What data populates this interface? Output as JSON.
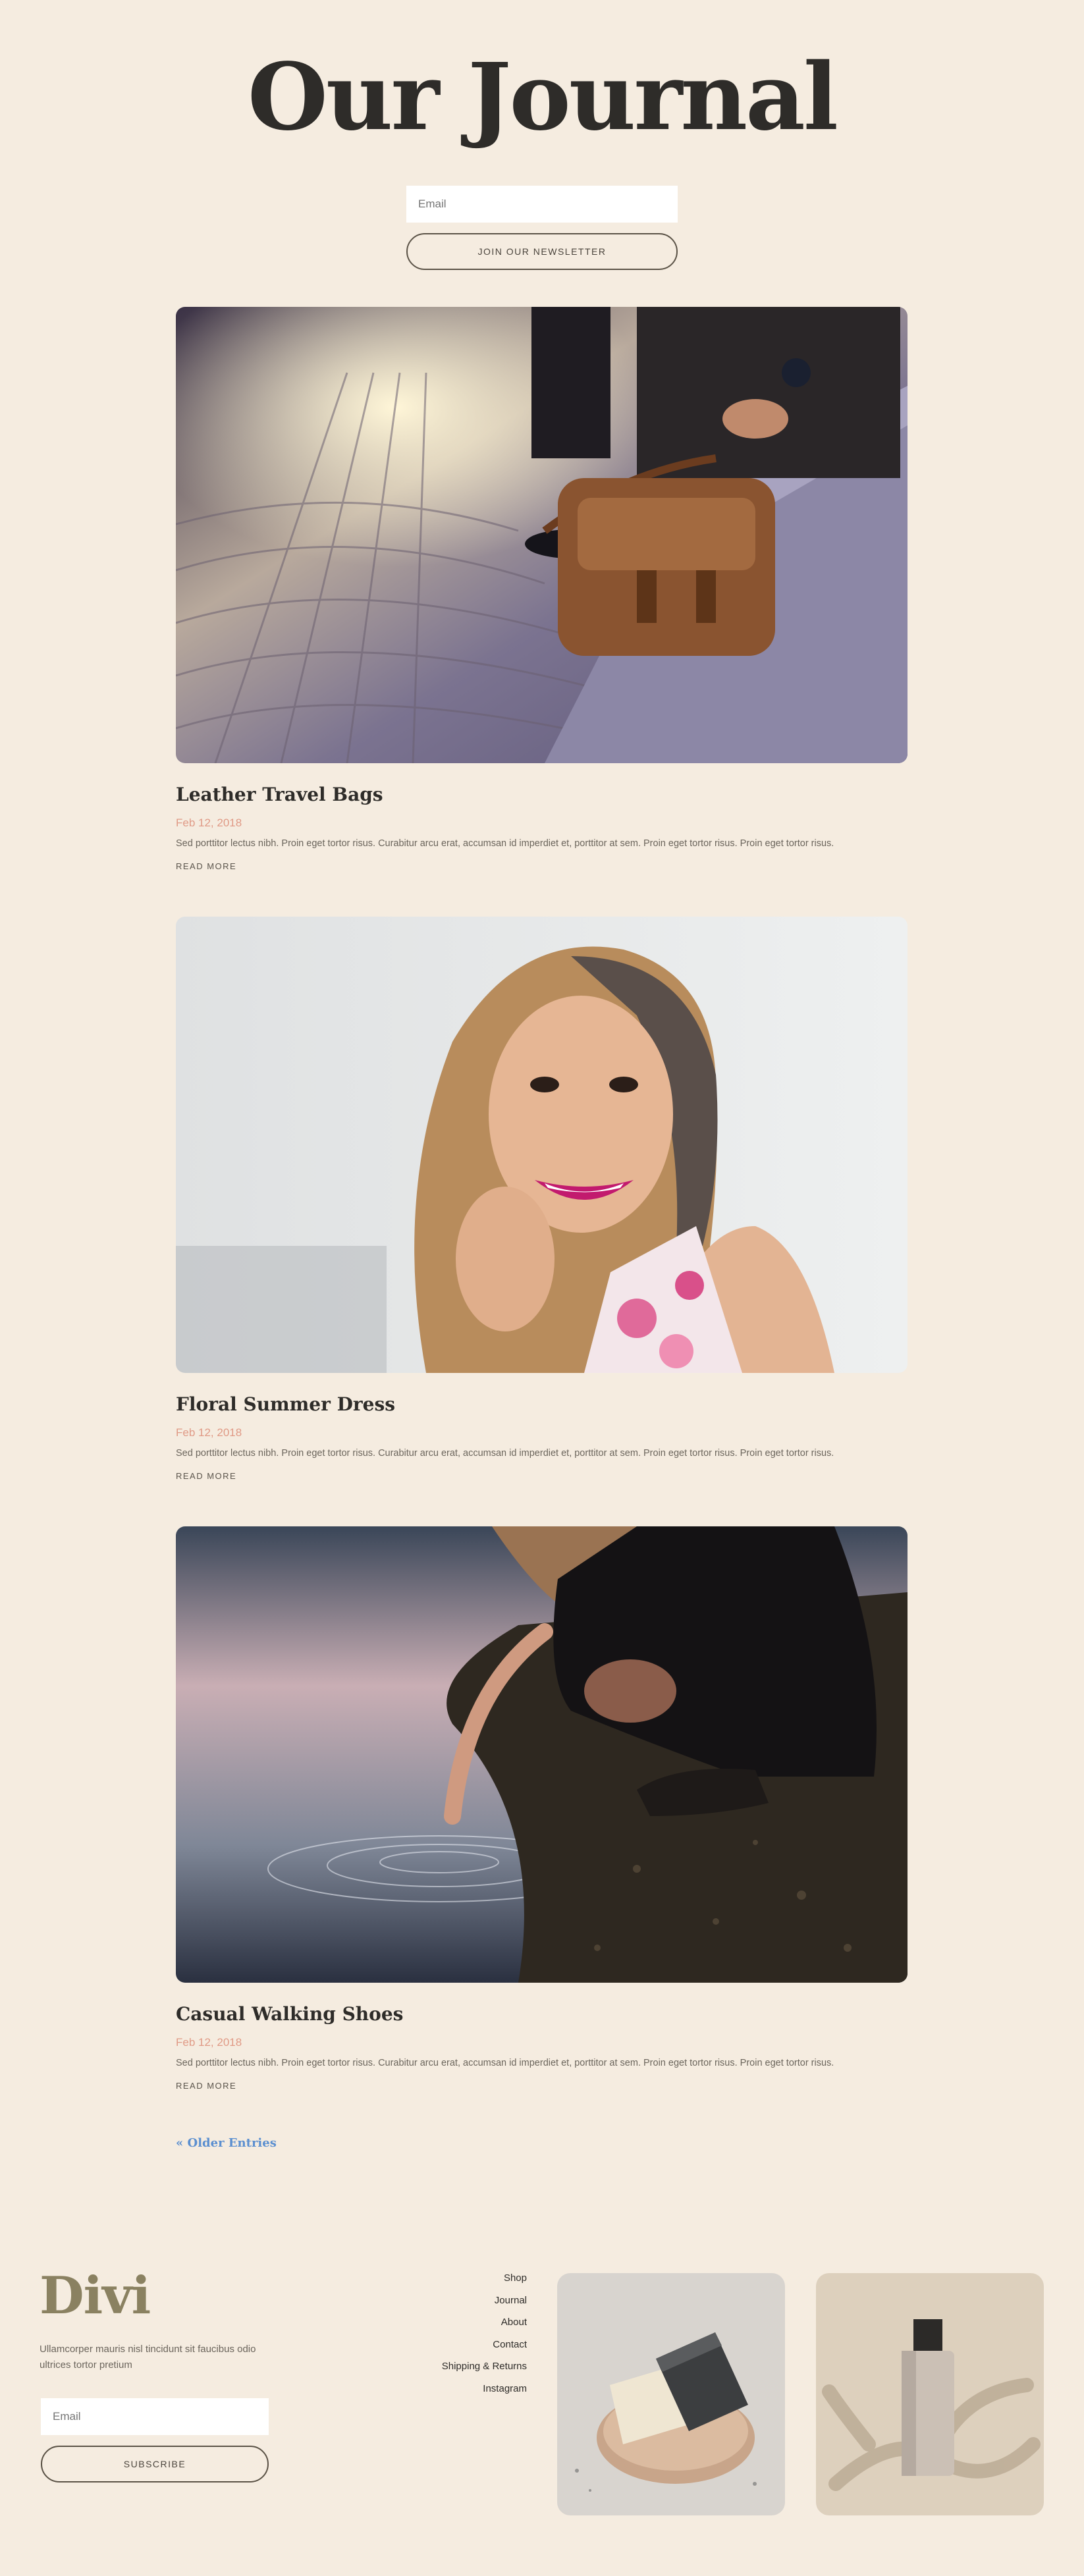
{
  "header": {
    "title": "Our Journal",
    "newsletter": {
      "email_placeholder": "Email",
      "button_label": "JOIN OUR NEWSLETTER"
    }
  },
  "posts": [
    {
      "title": "Leather Travel Bags",
      "date": "Feb 12, 2018",
      "excerpt": "Sed porttitor lectus nibh. Proin eget tortor risus. Curabitur arcu erat, accumsan id imperdiet et, porttitor at sem. Proin eget tortor risus. Proin eget tortor risus.",
      "read_more": "READ MORE",
      "image": "leather-bag-photo"
    },
    {
      "title": "Floral Summer Dress",
      "date": "Feb 12, 2018",
      "excerpt": "Sed porttitor lectus nibh. Proin eget tortor risus. Curabitur arcu erat, accumsan id imperdiet et, porttitor at sem. Proin eget tortor risus. Proin eget tortor risus.",
      "read_more": "READ MORE",
      "image": "smiling-woman-photo"
    },
    {
      "title": "Casual Walking Shoes",
      "date": "Feb 12, 2018",
      "excerpt": "Sed porttitor lectus nibh. Proin eget tortor risus. Curabitur arcu erat, accumsan id imperdiet et, porttitor at sem. Proin eget tortor risus. Proin eget tortor risus.",
      "read_more": "READ MORE",
      "image": "woman-at-water-photo"
    }
  ],
  "pagination": {
    "older_label": "« Older Entries"
  },
  "footer": {
    "logo": "Divi",
    "text": "Ullamcorper mauris nisl tincidunt sit faucibus odio ultrices tortor pretium",
    "email_placeholder": "Email",
    "subscribe_label": "SUBSCRIBE",
    "menu": [
      "Shop",
      "Journal",
      "About",
      "Contact",
      "Shipping & Returns",
      "Instagram"
    ],
    "images": [
      "soap-bars-photo",
      "cosmetic-bottle-photo"
    ]
  },
  "colors": {
    "background": "#f5ece0",
    "heading": "#2e2c29",
    "date": "#e09a86",
    "link": "#5b8fd0",
    "logo": "#8a8161"
  }
}
